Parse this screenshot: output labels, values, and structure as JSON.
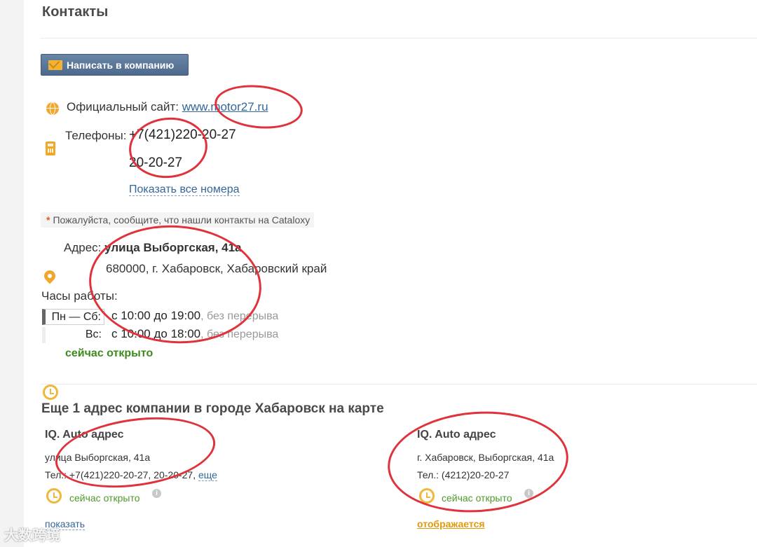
{
  "section_title": "Контакты",
  "write_button": "Написать в компанию",
  "site": {
    "label": "Официальный сайт:",
    "url": "www.motor27.ru"
  },
  "phones": {
    "label": "Телефоны:",
    "numbers": [
      "+7(421)220-20-27",
      "20-20-27"
    ],
    "show_all": "Показать все номера"
  },
  "note": {
    "star": "*",
    "text": "Пожалуйста, сообщите, что нашли контакты на Cataloxy"
  },
  "address": {
    "label": "Адрес:",
    "street": "улица Выборгская, 41а",
    "city": "680000, г. Хабаровск, Хабаровский край"
  },
  "hours": {
    "label": "Часы работы:",
    "rows": [
      {
        "day": "Пн — Сб:",
        "time": "с 10:00 до 19:00",
        "note": ", без перерыва"
      },
      {
        "day": "Вс:",
        "time": "с 10:00 до 18:00",
        "note": ", без перерыва"
      }
    ],
    "status": "сейчас открыто"
  },
  "other_addresses": {
    "heading": "Еще 1 адрес компании в городе Хабаровск на карте",
    "cards": [
      {
        "name": "IQ. Auto адрес",
        "address": "улица Выборгская, 41а",
        "phone": "Тел.: +7(421)220-20-27, 20-20-27,",
        "more": "еще",
        "status": "сейчас открыто",
        "action": "показать"
      },
      {
        "name": "IQ. Auto адрес",
        "address": "г. Хабаровск, Выборгская, 41а",
        "phone": "Тел.: (4212)20-20-27",
        "status": "сейчас открыто",
        "action": "отображается"
      }
    ]
  },
  "info_icon_glyph": "i",
  "watermark": "大数跨境",
  "colors": {
    "button": "#5a7799",
    "link": "#336699",
    "open": "#3d8a1e",
    "accent_icon": "#f0a72c",
    "highlight_circle": "#e0323a"
  }
}
